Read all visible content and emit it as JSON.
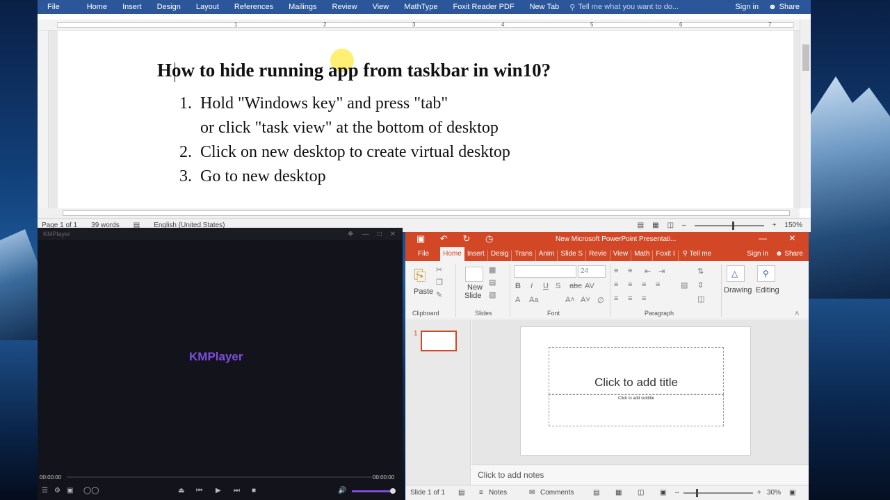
{
  "word": {
    "tabs": [
      "File",
      "Home",
      "Insert",
      "Design",
      "Layout",
      "References",
      "Mailings",
      "Review",
      "View",
      "MathType",
      "Foxit Reader PDF",
      "New Tab"
    ],
    "tell_me": "Tell me what you want to do...",
    "sign_in": "Sign in",
    "share": "Share",
    "ruler_numbers": [
      "1",
      "2",
      "3",
      "4",
      "5",
      "6",
      "7"
    ],
    "title": "How to hide running app from taskbar in win10?",
    "steps": [
      {
        "num": "1.",
        "text": "Hold \"Windows key\" and press \"tab\""
      },
      {
        "num": "",
        "text": "or click \"task view\" at the bottom of desktop"
      },
      {
        "num": "2.",
        "text": "Click on new desktop to create virtual desktop"
      },
      {
        "num": "3.",
        "text": "Go to new desktop"
      }
    ],
    "status": {
      "page": "Page 1 of 1",
      "words": "39 words",
      "language": "English (United States)",
      "zoom": "150%"
    }
  },
  "kmplayer": {
    "title": "KMPlayer",
    "logo": "KMPlayer",
    "time_current": "00:00:00",
    "time_total": "00:00:00",
    "volume_fraction": 0.9
  },
  "powerpoint": {
    "title": "New Microsoft PowerPoint Presentati...",
    "tabs": [
      "File",
      "Home",
      "Insert",
      "Desig",
      "Trans",
      "Anim",
      "Slide S",
      "Revie",
      "View",
      "Math",
      "Foxit I"
    ],
    "tell_me": "Tell me",
    "sign_in": "Sign in",
    "share": "Share",
    "ribbon": {
      "paste": "Paste",
      "new_slide": "New",
      "new_slide_2": "Slide",
      "font_size": "24",
      "drawing": "Drawing",
      "editing": "Editing",
      "groups": [
        "Clipboard",
        "Slides",
        "Font",
        "Paragraph"
      ]
    },
    "slide_number": "1",
    "title_placeholder": "Click to add title",
    "subtitle_placeholder": "Click to add subtitle",
    "notes_placeholder": "Click to add notes",
    "status": {
      "slide": "Slide 1 of 1",
      "notes": "Notes",
      "comments": "Comments",
      "zoom": "30%"
    }
  },
  "colors": {
    "word_accent": "#2b579a",
    "ppt_accent": "#d24726",
    "km_accent": "#7d4dde"
  }
}
